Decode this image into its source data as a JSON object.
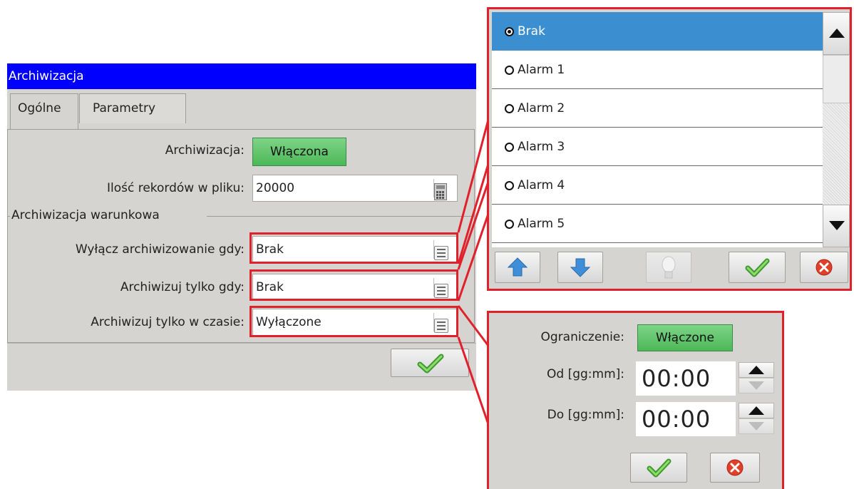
{
  "dialog": {
    "title": "Archiwizacja",
    "tabs": [
      {
        "label": "Ogólne",
        "active": true
      },
      {
        "label": "Parametry",
        "active": false
      }
    ],
    "archiving": {
      "label": "Archiwizacja:",
      "value": "Włączona"
    },
    "records": {
      "label": "Ilość rekordów w pliku:",
      "value": "20000"
    },
    "conditional_group": {
      "title": "Archiwizacja warunkowa",
      "disable_when": {
        "label": "Wyłącz archiwizowanie gdy:",
        "value": "Brak"
      },
      "only_when": {
        "label": "Archiwizuj tylko gdy:",
        "value": "Brak"
      },
      "only_in_time": {
        "label": "Archiwizuj tylko w czasie:",
        "value": "Wyłączone"
      }
    },
    "ok_icon": "checkmark-icon"
  },
  "select_popup": {
    "items": [
      {
        "label": "Brak",
        "selected": true
      },
      {
        "label": "Alarm 1",
        "selected": false
      },
      {
        "label": "Alarm 2",
        "selected": false
      },
      {
        "label": "Alarm 3",
        "selected": false
      },
      {
        "label": "Alarm 4",
        "selected": false
      },
      {
        "label": "Alarm 5",
        "selected": false
      }
    ],
    "toolbar_icons": [
      "arrow-up-icon",
      "arrow-down-icon",
      "lightbulb-icon",
      "checkmark-icon",
      "cancel-icon"
    ]
  },
  "time_popup": {
    "limit": {
      "label": "Ograniczenie:",
      "value": "Włączone"
    },
    "from": {
      "label": "Od [gg:mm]:",
      "value": "00:00"
    },
    "to": {
      "label": "Do [gg:mm]:",
      "value": "00:00"
    }
  },
  "colors": {
    "title_bar": "#0000ff",
    "toggle_on": "#5fc46c",
    "selected_item": "#3b8fd0",
    "highlight_border": "#e0202a",
    "window_bg": "#d6d4d0"
  }
}
